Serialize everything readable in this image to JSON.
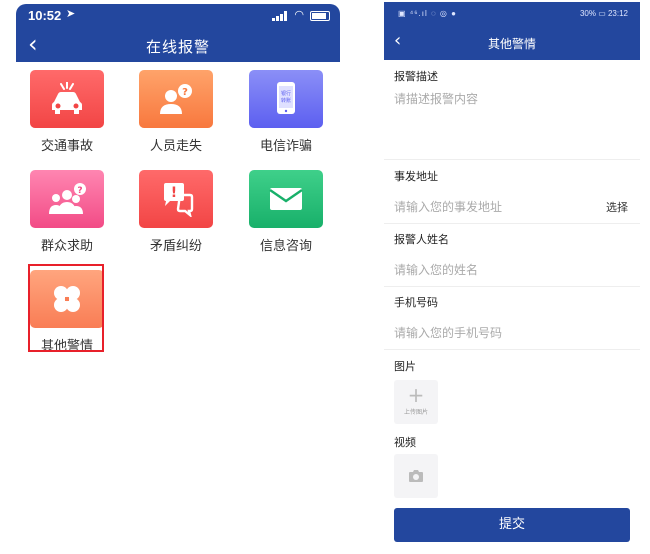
{
  "left": {
    "status": {
      "time": "10:52"
    },
    "nav": {
      "title": "在线报警",
      "back": "‹"
    },
    "tiles": [
      {
        "label": "交通事故",
        "icon": "car-crash-icon",
        "color": "#f24545"
      },
      {
        "label": "人员走失",
        "icon": "missing-person-icon",
        "color": "#f8783e"
      },
      {
        "label": "电信诈骗",
        "icon": "phone-fraud-icon",
        "color": "#5c5ff0",
        "badge": "银行\n转账"
      },
      {
        "label": "群众求助",
        "icon": "crowd-help-icon",
        "color": "#f24b86"
      },
      {
        "label": "矛盾纠纷",
        "icon": "dispute-icon",
        "color": "#f24545"
      },
      {
        "label": "信息咨询",
        "icon": "mail-icon",
        "color": "#18b06a"
      },
      {
        "label": "其他警情",
        "icon": "clover-icon",
        "color": "#f97d55",
        "highlighted": true
      }
    ]
  },
  "right": {
    "status": {
      "left": "▣ ⁴⁶.ıl ◌ ◎ ●",
      "right": "30% ▭ 23:12"
    },
    "nav": {
      "title": "其他警情",
      "back": "‹"
    },
    "form": {
      "desc_label": "报警描述",
      "desc_placeholder": "请描述报警内容",
      "addr_label": "事发地址",
      "addr_placeholder": "请输入您的事发地址",
      "addr_select": "选择",
      "name_label": "报警人姓名",
      "name_placeholder": "请输入您的姓名",
      "phone_label": "手机号码",
      "phone_placeholder": "请输入您的手机号码",
      "image_label": "图片",
      "image_upload": "上传图片",
      "video_label": "视频",
      "submit": "提交"
    }
  }
}
